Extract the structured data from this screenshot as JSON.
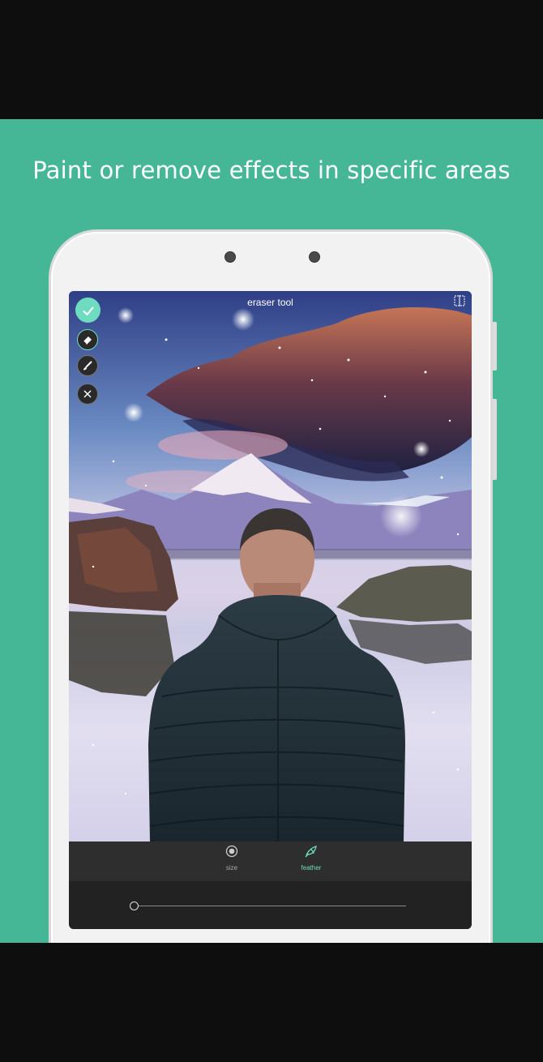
{
  "banner": {
    "background": "#45b797",
    "headline": "Paint or remove effects in specific areas"
  },
  "screen": {
    "title": "eraser tool",
    "compare_icon": "compare-split-icon"
  },
  "toolbar": {
    "apply_icon": "checkmark-icon",
    "eraser_icon": "eraser-icon",
    "brush_icon": "brush-icon",
    "close_icon": "close-icon"
  },
  "tabs": [
    {
      "label": "size",
      "icon": "size-circle-icon",
      "active": false
    },
    {
      "label": "feather",
      "icon": "feather-icon",
      "active": true
    }
  ],
  "slider": {
    "value": 0.0
  },
  "colors": {
    "accent": "#6fdcc0",
    "panel": "#2e2e2e"
  }
}
